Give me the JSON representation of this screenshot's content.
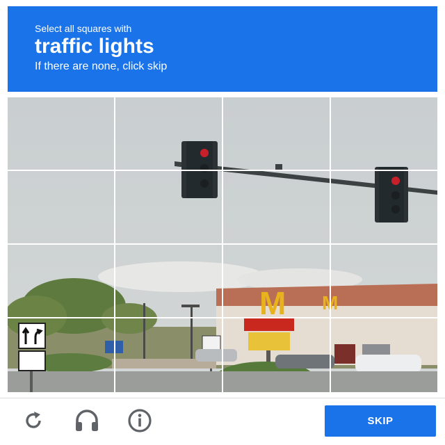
{
  "header": {
    "instruction": "Select all squares with",
    "target": "traffic lights",
    "hint": "If there are none, click skip"
  },
  "grid": {
    "rows": 4,
    "columns": 4
  },
  "footer": {
    "icons": [
      "reload-icon",
      "audio-headphones-icon",
      "info-icon"
    ],
    "skip_label": "SKIP"
  },
  "colors": {
    "accent": "#1a73e8",
    "header_text": "#ffffff",
    "icon": "#5f6368"
  }
}
